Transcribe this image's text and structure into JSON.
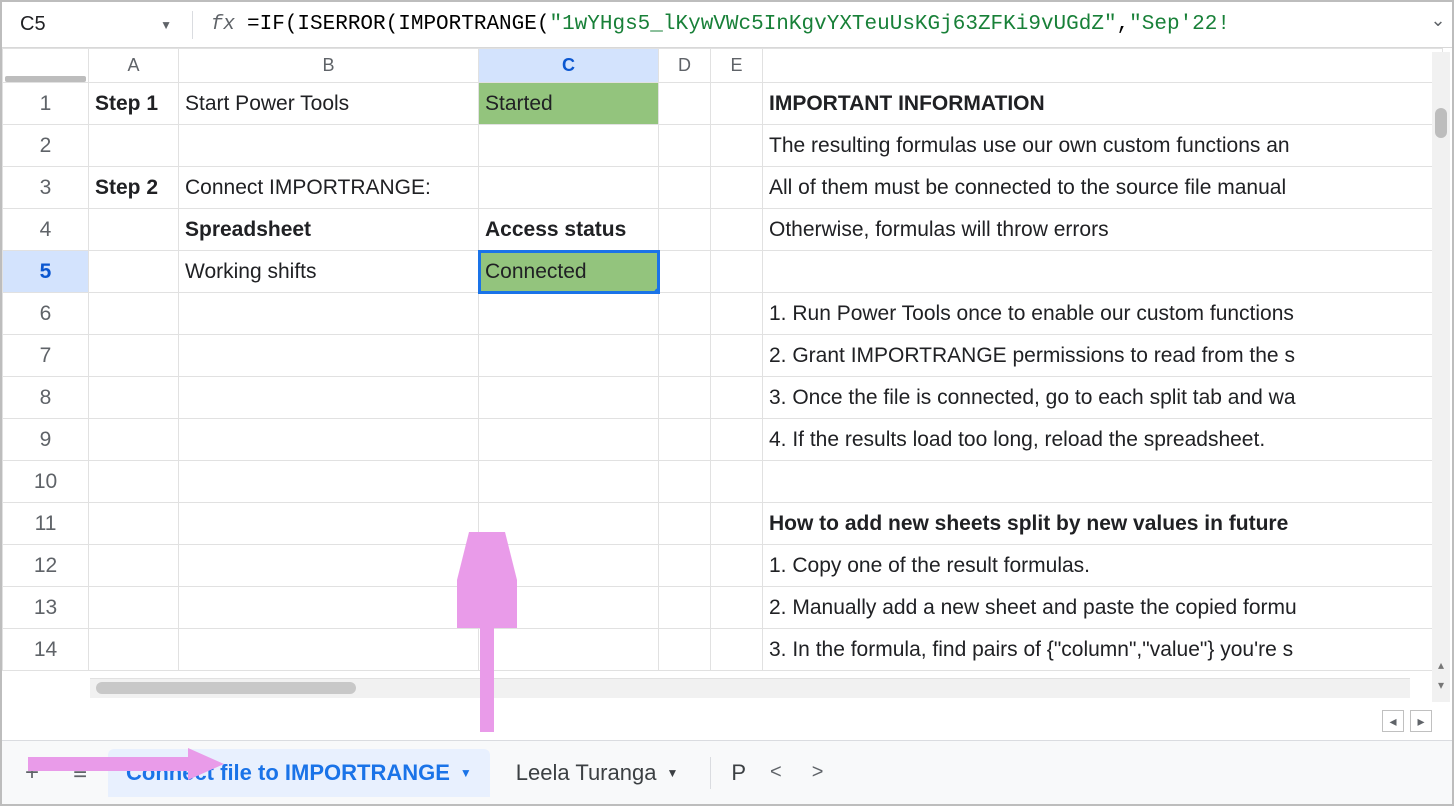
{
  "name_box": "C5",
  "formula": {
    "prefix": "=IF(ISERROR(IMPORTRANGE(",
    "arg1": "\"1wYHgs5_lKywVWc5InKgvYXTeuUsKGj63ZFKi9vUGdZ\"",
    "sep": ",",
    "arg2": "\"Sep'22!"
  },
  "columns": [
    "A",
    "B",
    "C",
    "D",
    "E",
    ""
  ],
  "selected_column": "C",
  "selected_row": "5",
  "rows": {
    "1": {
      "A": "Step 1",
      "B": "Start Power Tools",
      "C": "Started",
      "F": "IMPORTANT INFORMATION"
    },
    "2": {
      "F": "The resulting formulas use our own custom functions an"
    },
    "3": {
      "A": "Step 2",
      "B": "Connect IMPORTRANGE:",
      "F": "All of them must be connected to the source file manual"
    },
    "4": {
      "B": "Spreadsheet",
      "C": "Access status",
      "F": "Otherwise, formulas will throw errors"
    },
    "5": {
      "B": "Working shifts",
      "C": "Connected"
    },
    "6": {
      "F": "1. Run Power Tools once to enable our custom functions"
    },
    "7": {
      "F": "2. Grant IMPORTRANGE permissions to read from the s"
    },
    "8": {
      "F": "3. Once the file is connected, go to each split tab and wa"
    },
    "9": {
      "F": "4. If the results load too long, reload the spreadsheet."
    },
    "10": {},
    "11": {
      "F": "How to add new sheets split by new values in future"
    },
    "12": {
      "F": "1. Copy one of the result formulas."
    },
    "13": {
      "F": "2. Manually add a new sheet and paste the copied formu"
    },
    "14": {
      "F": "3. In the formula, find pairs of {\"column\",\"value\"} you're s"
    }
  },
  "tabs": {
    "active": "Connect file to IMPORTRANGE",
    "next": "Leela Turanga",
    "partial": "P"
  },
  "colors": {
    "green_fill": "#93c47d",
    "selection_blue": "#1a73e8",
    "arrow_pink": "#e99be9"
  }
}
